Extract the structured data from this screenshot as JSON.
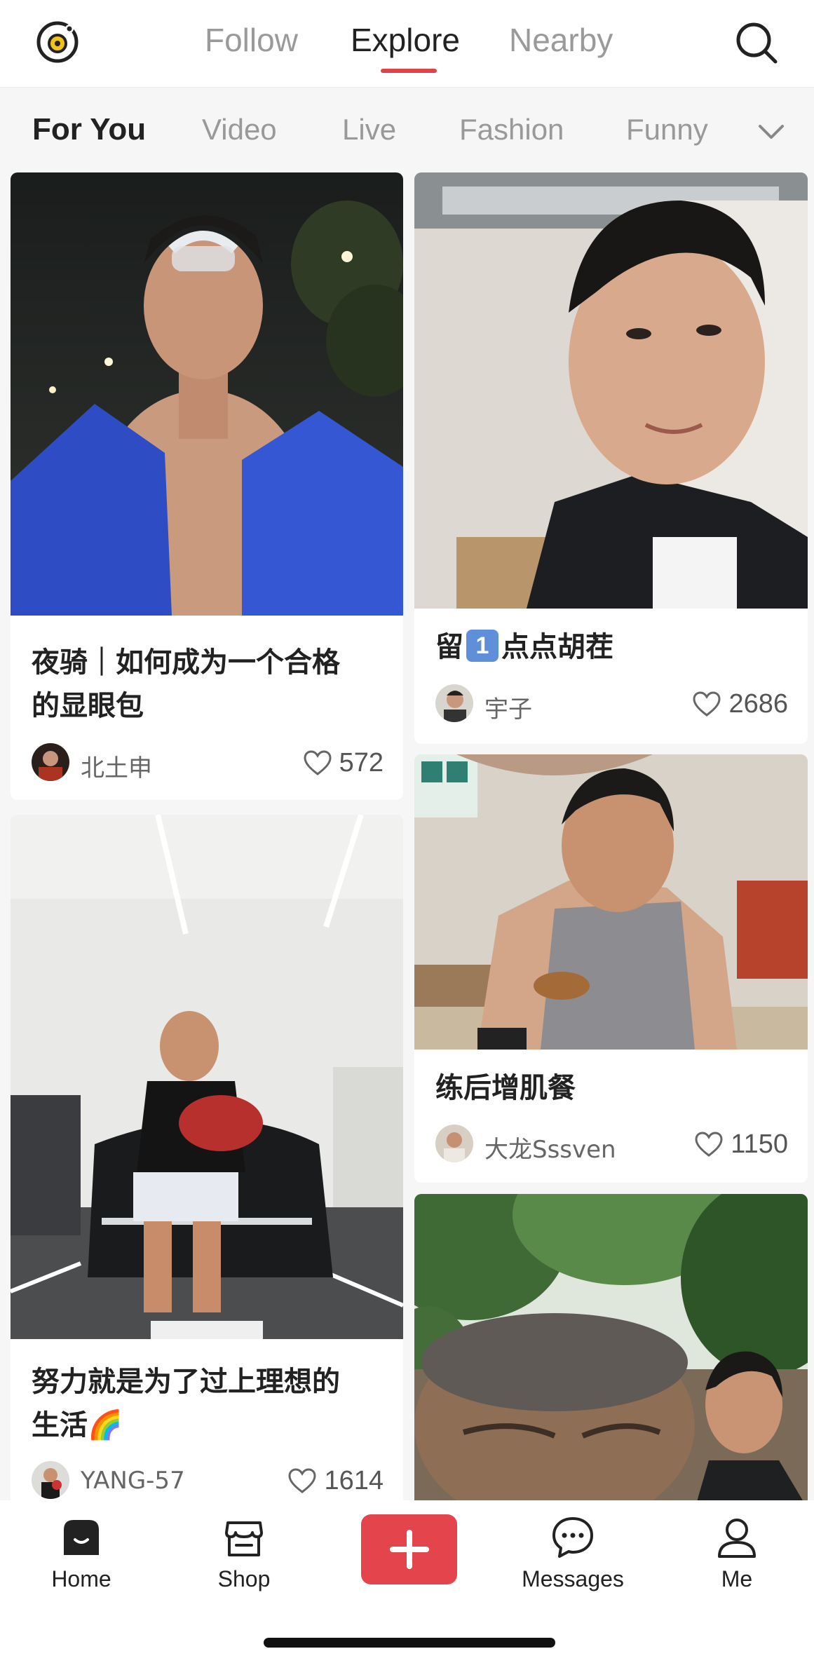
{
  "header": {
    "tabs": [
      {
        "label": "Follow"
      },
      {
        "label": "Explore"
      },
      {
        "label": "Nearby"
      }
    ],
    "active_tab": "Explore",
    "accent_color": "#e0424a",
    "icons": [
      "logo-icon",
      "search-icon"
    ]
  },
  "categories": {
    "items": [
      "For You",
      "Video",
      "Live",
      "Fashion",
      "Funny"
    ],
    "active": "For You"
  },
  "feed": {
    "cards": [
      {
        "title_line1": "夜骑｜如何成为一个合格",
        "title_line2": "的显眼包",
        "author": "北土申",
        "likes": "572"
      },
      {
        "title_pre": "留",
        "title_badge": "1",
        "title_post": "点点胡茬",
        "author": "宇子",
        "likes": "2686"
      },
      {
        "title": "练后增肌餐",
        "author": "大龙Sssven",
        "likes": "1150"
      },
      {
        "title_line1": "努力就是为了过上理想的",
        "title_line2": "生活🌈",
        "author": "YANG-57",
        "likes": "1614"
      }
    ]
  },
  "bottom_nav": {
    "items": [
      {
        "label": "Home"
      },
      {
        "label": "Shop"
      },
      {
        "label": ""
      },
      {
        "label": "Messages"
      },
      {
        "label": "Me"
      }
    ],
    "add_button_color": "#e4444c"
  }
}
